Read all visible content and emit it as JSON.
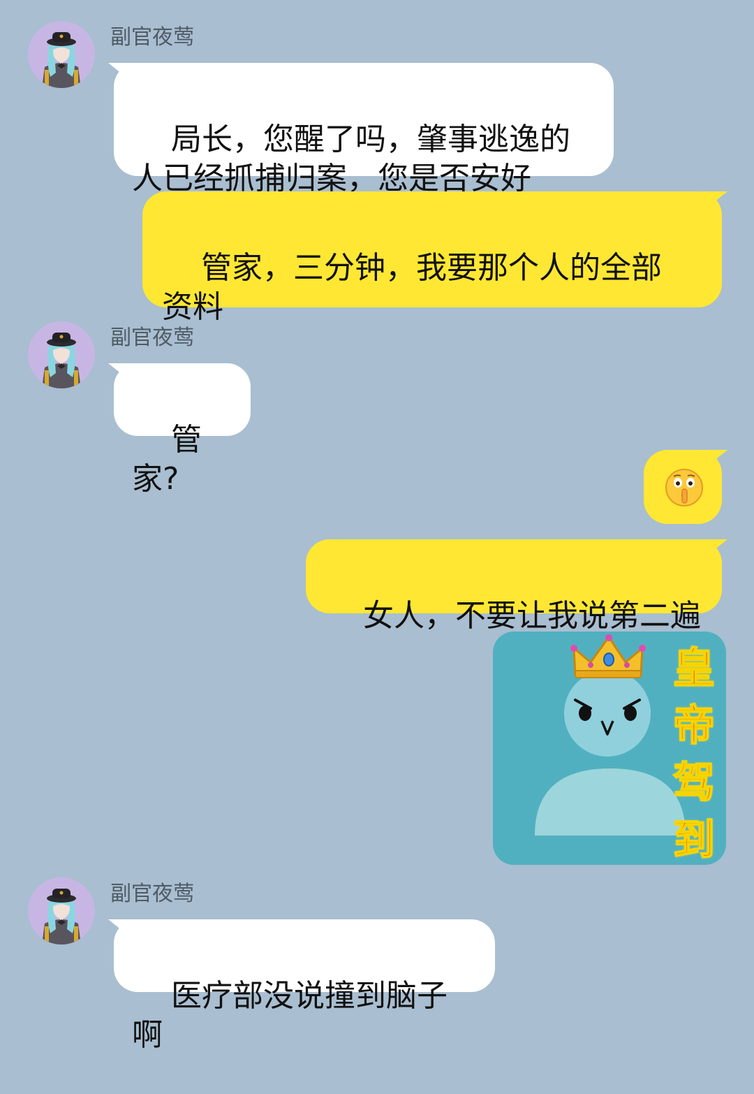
{
  "colors": {
    "background": "#a9bed0",
    "incoming_bubble": "#ffffff",
    "outgoing_bubble": "#ffe733",
    "avatar_background": "#c7b6e4",
    "sticker_background": "#51b0c0",
    "sticker_text": "#ee2a1b"
  },
  "messages": [
    {
      "sender": "副官夜莺",
      "direction": "incoming",
      "text": "局长，您醒了吗，肇事逃逸的\n人已经抓捕归案，您是否安好"
    },
    {
      "direction": "outgoing",
      "text": "管家，三分钟，我要那个人的全部\n资料"
    },
    {
      "sender": "副官夜莺",
      "direction": "incoming",
      "text": "管家?"
    },
    {
      "direction": "outgoing",
      "type": "emoji",
      "icon": "shushing-face-icon"
    },
    {
      "direction": "outgoing",
      "text": "女人，不要让我说第二遍"
    },
    {
      "direction": "outgoing",
      "type": "sticker",
      "icon": "crowned-bird-icon",
      "sticker_text": [
        "皇",
        "帝",
        "驾",
        "到"
      ]
    },
    {
      "sender": "副官夜莺",
      "direction": "incoming",
      "text": "医疗部没说撞到脑子啊"
    }
  ]
}
